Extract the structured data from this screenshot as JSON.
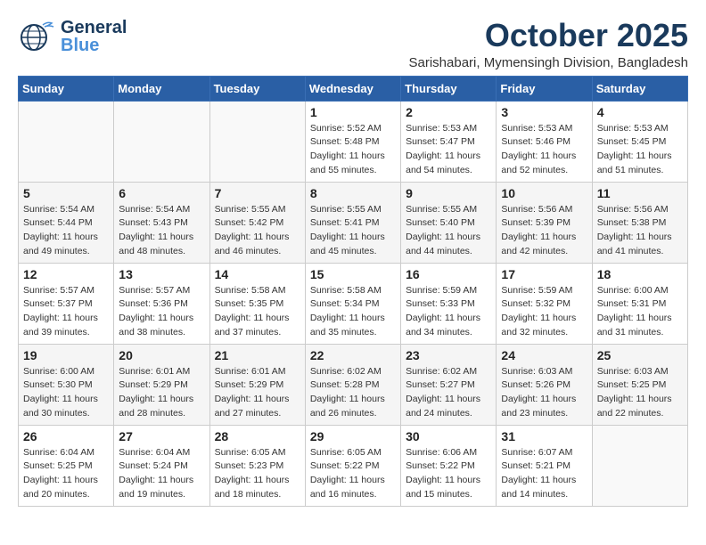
{
  "header": {
    "logo_general": "General",
    "logo_blue": "Blue",
    "month": "October 2025",
    "location": "Sarishabari, Mymensingh Division, Bangladesh"
  },
  "weekdays": [
    "Sunday",
    "Monday",
    "Tuesday",
    "Wednesday",
    "Thursday",
    "Friday",
    "Saturday"
  ],
  "weeks": [
    [
      {
        "day": "",
        "info": ""
      },
      {
        "day": "",
        "info": ""
      },
      {
        "day": "",
        "info": ""
      },
      {
        "day": "1",
        "info": "Sunrise: 5:52 AM\nSunset: 5:48 PM\nDaylight: 11 hours\nand 55 minutes."
      },
      {
        "day": "2",
        "info": "Sunrise: 5:53 AM\nSunset: 5:47 PM\nDaylight: 11 hours\nand 54 minutes."
      },
      {
        "day": "3",
        "info": "Sunrise: 5:53 AM\nSunset: 5:46 PM\nDaylight: 11 hours\nand 52 minutes."
      },
      {
        "day": "4",
        "info": "Sunrise: 5:53 AM\nSunset: 5:45 PM\nDaylight: 11 hours\nand 51 minutes."
      }
    ],
    [
      {
        "day": "5",
        "info": "Sunrise: 5:54 AM\nSunset: 5:44 PM\nDaylight: 11 hours\nand 49 minutes."
      },
      {
        "day": "6",
        "info": "Sunrise: 5:54 AM\nSunset: 5:43 PM\nDaylight: 11 hours\nand 48 minutes."
      },
      {
        "day": "7",
        "info": "Sunrise: 5:55 AM\nSunset: 5:42 PM\nDaylight: 11 hours\nand 46 minutes."
      },
      {
        "day": "8",
        "info": "Sunrise: 5:55 AM\nSunset: 5:41 PM\nDaylight: 11 hours\nand 45 minutes."
      },
      {
        "day": "9",
        "info": "Sunrise: 5:55 AM\nSunset: 5:40 PM\nDaylight: 11 hours\nand 44 minutes."
      },
      {
        "day": "10",
        "info": "Sunrise: 5:56 AM\nSunset: 5:39 PM\nDaylight: 11 hours\nand 42 minutes."
      },
      {
        "day": "11",
        "info": "Sunrise: 5:56 AM\nSunset: 5:38 PM\nDaylight: 11 hours\nand 41 minutes."
      }
    ],
    [
      {
        "day": "12",
        "info": "Sunrise: 5:57 AM\nSunset: 5:37 PM\nDaylight: 11 hours\nand 39 minutes."
      },
      {
        "day": "13",
        "info": "Sunrise: 5:57 AM\nSunset: 5:36 PM\nDaylight: 11 hours\nand 38 minutes."
      },
      {
        "day": "14",
        "info": "Sunrise: 5:58 AM\nSunset: 5:35 PM\nDaylight: 11 hours\nand 37 minutes."
      },
      {
        "day": "15",
        "info": "Sunrise: 5:58 AM\nSunset: 5:34 PM\nDaylight: 11 hours\nand 35 minutes."
      },
      {
        "day": "16",
        "info": "Sunrise: 5:59 AM\nSunset: 5:33 PM\nDaylight: 11 hours\nand 34 minutes."
      },
      {
        "day": "17",
        "info": "Sunrise: 5:59 AM\nSunset: 5:32 PM\nDaylight: 11 hours\nand 32 minutes."
      },
      {
        "day": "18",
        "info": "Sunrise: 6:00 AM\nSunset: 5:31 PM\nDaylight: 11 hours\nand 31 minutes."
      }
    ],
    [
      {
        "day": "19",
        "info": "Sunrise: 6:00 AM\nSunset: 5:30 PM\nDaylight: 11 hours\nand 30 minutes."
      },
      {
        "day": "20",
        "info": "Sunrise: 6:01 AM\nSunset: 5:29 PM\nDaylight: 11 hours\nand 28 minutes."
      },
      {
        "day": "21",
        "info": "Sunrise: 6:01 AM\nSunset: 5:29 PM\nDaylight: 11 hours\nand 27 minutes."
      },
      {
        "day": "22",
        "info": "Sunrise: 6:02 AM\nSunset: 5:28 PM\nDaylight: 11 hours\nand 26 minutes."
      },
      {
        "day": "23",
        "info": "Sunrise: 6:02 AM\nSunset: 5:27 PM\nDaylight: 11 hours\nand 24 minutes."
      },
      {
        "day": "24",
        "info": "Sunrise: 6:03 AM\nSunset: 5:26 PM\nDaylight: 11 hours\nand 23 minutes."
      },
      {
        "day": "25",
        "info": "Sunrise: 6:03 AM\nSunset: 5:25 PM\nDaylight: 11 hours\nand 22 minutes."
      }
    ],
    [
      {
        "day": "26",
        "info": "Sunrise: 6:04 AM\nSunset: 5:25 PM\nDaylight: 11 hours\nand 20 minutes."
      },
      {
        "day": "27",
        "info": "Sunrise: 6:04 AM\nSunset: 5:24 PM\nDaylight: 11 hours\nand 19 minutes."
      },
      {
        "day": "28",
        "info": "Sunrise: 6:05 AM\nSunset: 5:23 PM\nDaylight: 11 hours\nand 18 minutes."
      },
      {
        "day": "29",
        "info": "Sunrise: 6:05 AM\nSunset: 5:22 PM\nDaylight: 11 hours\nand 16 minutes."
      },
      {
        "day": "30",
        "info": "Sunrise: 6:06 AM\nSunset: 5:22 PM\nDaylight: 11 hours\nand 15 minutes."
      },
      {
        "day": "31",
        "info": "Sunrise: 6:07 AM\nSunset: 5:21 PM\nDaylight: 11 hours\nand 14 minutes."
      },
      {
        "day": "",
        "info": ""
      }
    ]
  ]
}
